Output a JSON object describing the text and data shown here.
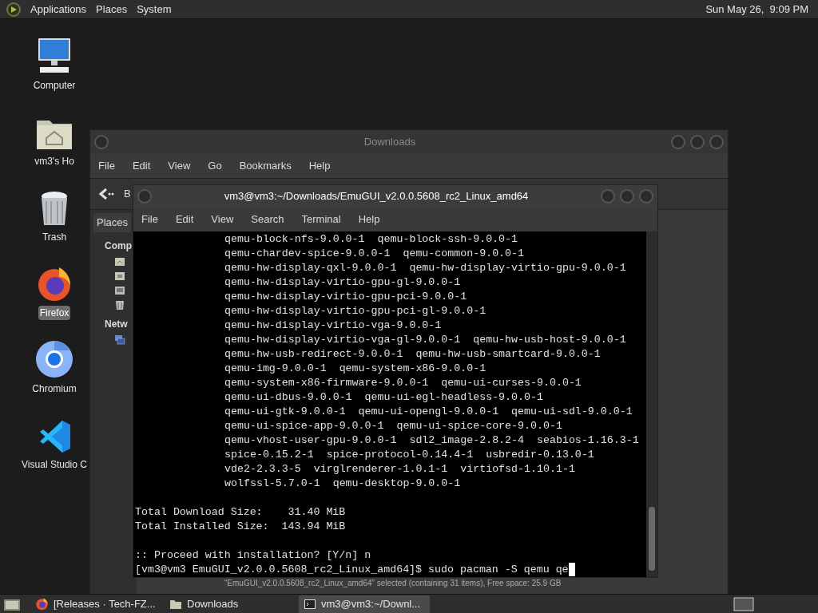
{
  "top_panel": {
    "menus": [
      "Applications",
      "Places",
      "System"
    ],
    "clock": "Sun May 26,  9:09 PM"
  },
  "desktop_icons": [
    {
      "kind": "computer",
      "label": "Computer",
      "selected": false
    },
    {
      "kind": "home",
      "label": "vm3's Ho",
      "selected": false
    },
    {
      "kind": "trash",
      "label": "Trash",
      "selected": false
    },
    {
      "kind": "firefox",
      "label": "Firefox",
      "selected": true
    },
    {
      "kind": "chromium",
      "label": "Chromium",
      "selected": false
    },
    {
      "kind": "vscode",
      "label": "Visual Studio C",
      "selected": false
    }
  ],
  "file_manager": {
    "title": "Downloads",
    "menu": [
      "File",
      "Edit",
      "View",
      "Go",
      "Bookmarks",
      "Help"
    ],
    "toolbar_text": "B",
    "sidebar_tab": "Places",
    "sidebar_sections": [
      {
        "heading": "Comp",
        "items": [
          {
            "kind": "home"
          },
          {
            "kind": "desktop"
          },
          {
            "kind": "drive"
          },
          {
            "kind": "trash"
          }
        ]
      },
      {
        "heading": "Netw",
        "items": [
          {
            "kind": "network"
          }
        ]
      }
    ],
    "status": "“EmuGUI_v2.0.0.5608_rc2_Linux_amd64” selected (containing 31 items), Free space: 25.9 GB"
  },
  "terminal": {
    "title": "vm3@vm3:~/Downloads/EmuGUI_v2.0.0.5608_rc2_Linux_amd64",
    "menu": [
      "File",
      "Edit",
      "View",
      "Search",
      "Terminal",
      "Help"
    ],
    "lines": [
      {
        "kind": "package",
        "text": "qemu-block-nfs-9.0.0-1  qemu-block-ssh-9.0.0-1"
      },
      {
        "kind": "package",
        "text": "qemu-chardev-spice-9.0.0-1  qemu-common-9.0.0-1"
      },
      {
        "kind": "package",
        "text": "qemu-hw-display-qxl-9.0.0-1  qemu-hw-display-virtio-gpu-9.0.0-1"
      },
      {
        "kind": "package",
        "text": "qemu-hw-display-virtio-gpu-gl-9.0.0-1"
      },
      {
        "kind": "package",
        "text": "qemu-hw-display-virtio-gpu-pci-9.0.0-1"
      },
      {
        "kind": "package",
        "text": "qemu-hw-display-virtio-gpu-pci-gl-9.0.0-1"
      },
      {
        "kind": "package",
        "text": "qemu-hw-display-virtio-vga-9.0.0-1"
      },
      {
        "kind": "package",
        "text": "qemu-hw-display-virtio-vga-gl-9.0.0-1  qemu-hw-usb-host-9.0.0-1"
      },
      {
        "kind": "package",
        "text": "qemu-hw-usb-redirect-9.0.0-1  qemu-hw-usb-smartcard-9.0.0-1"
      },
      {
        "kind": "package",
        "text": "qemu-img-9.0.0-1  qemu-system-x86-9.0.0-1"
      },
      {
        "kind": "package",
        "text": "qemu-system-x86-firmware-9.0.0-1  qemu-ui-curses-9.0.0-1"
      },
      {
        "kind": "package",
        "text": "qemu-ui-dbus-9.0.0-1  qemu-ui-egl-headless-9.0.0-1"
      },
      {
        "kind": "package",
        "text": "qemu-ui-gtk-9.0.0-1  qemu-ui-opengl-9.0.0-1  qemu-ui-sdl-9.0.0-1"
      },
      {
        "kind": "package",
        "text": "qemu-ui-spice-app-9.0.0-1  qemu-ui-spice-core-9.0.0-1"
      },
      {
        "kind": "package",
        "text": "qemu-vhost-user-gpu-9.0.0-1  sdl2_image-2.8.2-4  seabios-1.16.3-1"
      },
      {
        "kind": "package",
        "text": "spice-0.15.2-1  spice-protocol-0.14.4-1  usbredir-0.13.0-1"
      },
      {
        "kind": "package",
        "text": "vde2-2.3.3-5  virglrenderer-1.0.1-1  virtiofsd-1.10.1-1"
      },
      {
        "kind": "package",
        "text": "wolfssl-5.7.0-1  qemu-desktop-9.0.0-1"
      },
      {
        "kind": "blank"
      },
      {
        "kind": "plain",
        "text": "Total Download Size:    31.40 MiB"
      },
      {
        "kind": "plain",
        "text": "Total Installed Size:  143.94 MiB"
      },
      {
        "kind": "blank"
      },
      {
        "kind": "plain",
        "text": ":: Proceed with installation? [Y/n] n"
      },
      {
        "kind": "prompt",
        "text": "[vm3@vm3 EmuGUI_v2.0.0.5608_rc2_Linux_amd64]$ sudo pacman -S qemu qe"
      }
    ]
  },
  "taskbar": [
    {
      "kind": "firefox",
      "label": "[Releases · Tech-FZ...",
      "selected": false
    },
    {
      "kind": "folder",
      "label": "Downloads",
      "selected": false
    },
    {
      "kind": "terminal",
      "label": "vm3@vm3:~/Downl...",
      "selected": true
    }
  ]
}
